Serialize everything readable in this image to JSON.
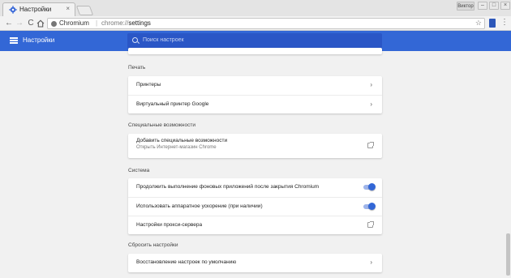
{
  "browser": {
    "tab_title": "Настройки",
    "tab_close": "×",
    "user_badge": "Виктор",
    "window_buttons": [
      "–",
      "□",
      "×"
    ],
    "origin": "Chromium",
    "url_separator": "|",
    "url_scheme": "chrome://",
    "url_path": "settings",
    "nav": {
      "back": "←",
      "forward": "→",
      "reload": "C"
    },
    "star": "☆",
    "menu": "⋮"
  },
  "header": {
    "title": "Настройки",
    "search_placeholder": "Поиск настроек",
    "accent_color": "#3367d6"
  },
  "sections": {
    "print": {
      "title": "Печать",
      "rows": [
        {
          "label": "Принтеры",
          "icon": "arrow-right-icon"
        },
        {
          "label": "Виртуальный принтер Google",
          "icon": "arrow-right-icon"
        }
      ]
    },
    "accessibility": {
      "title": "Специальные возможности",
      "rows": [
        {
          "label": "Добавить специальные возможности",
          "sublabel": "Открыть Интернет-магазин Chrome",
          "icon": "external-link-icon"
        }
      ]
    },
    "system": {
      "title": "Система",
      "rows": [
        {
          "label": "Продолжить выполнение фоновых приложений после закрытия Chromium",
          "toggle": true
        },
        {
          "label": "Использовать аппаратное ускорение (при наличии)",
          "toggle": true
        },
        {
          "label": "Настройки прокси-сервера",
          "icon": "external-link-icon"
        }
      ]
    },
    "reset": {
      "title": "Сбросить настройки",
      "rows": [
        {
          "label": "Восстановление настроек по умолчанию",
          "icon": "arrow-right-icon"
        }
      ]
    }
  },
  "arrow_glyph": "›"
}
